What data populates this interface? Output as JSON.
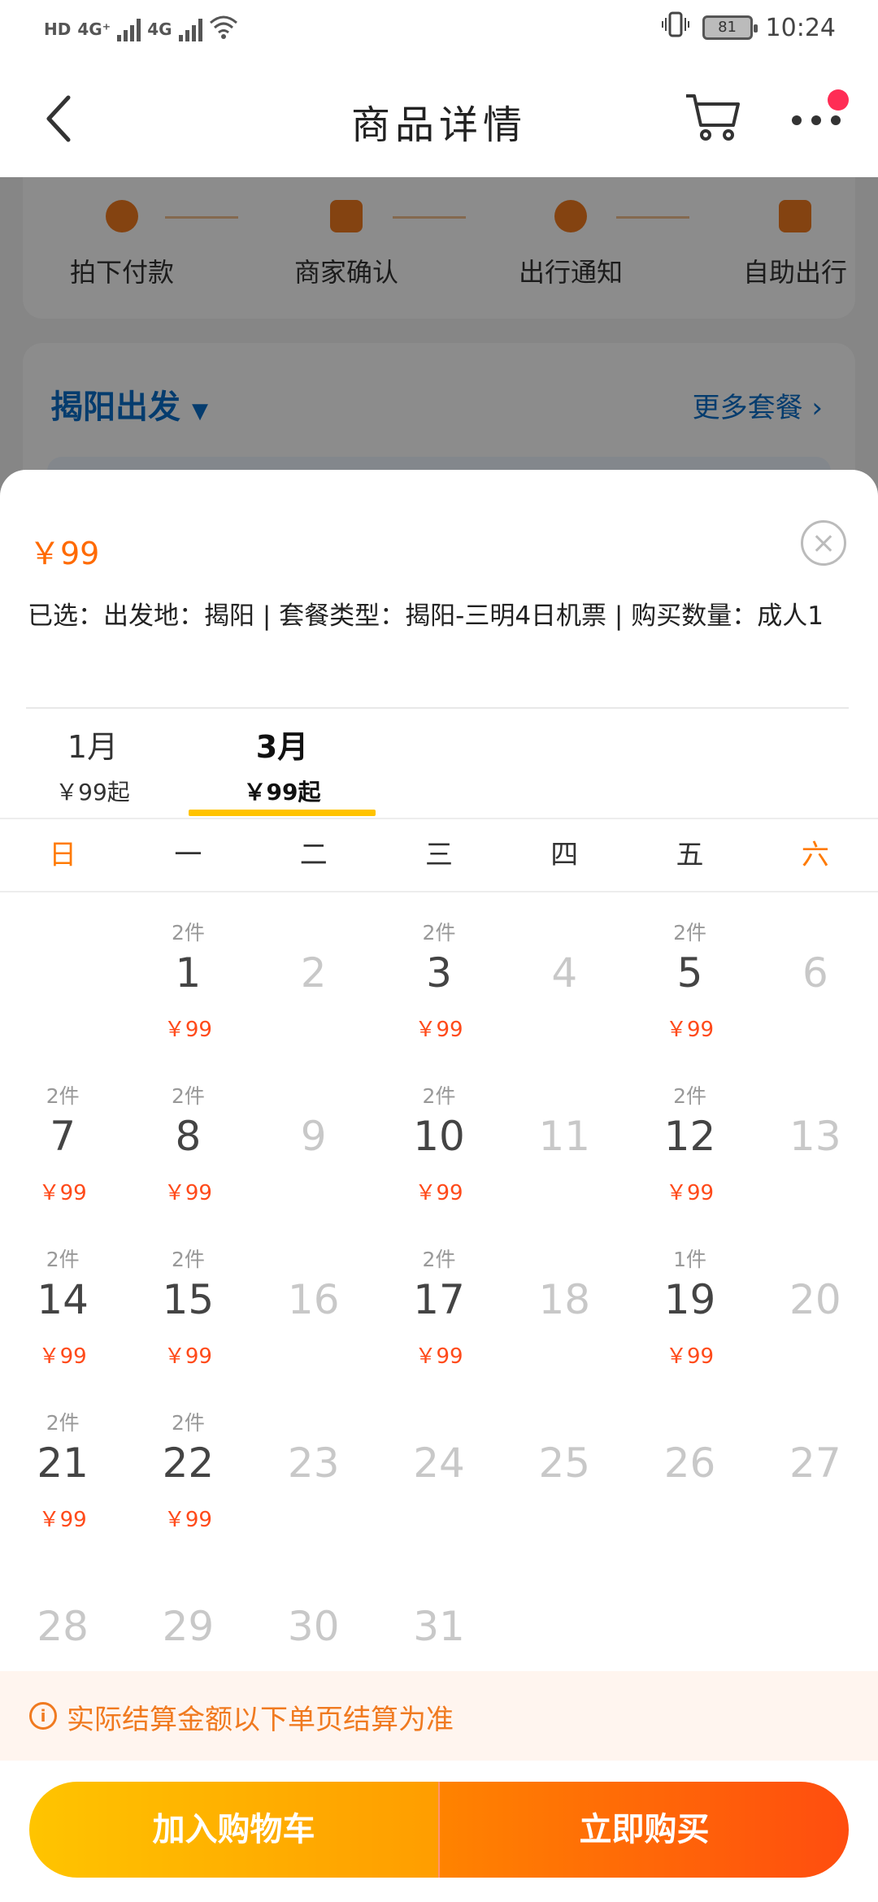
{
  "status_bar": {
    "left_badges": [
      "HD",
      "4G⁺",
      "4G"
    ],
    "battery": "81",
    "time": "10:24"
  },
  "header": {
    "title": "商品详情",
    "icons": [
      "back-arrow-icon",
      "cart-icon",
      "more-dots-icon"
    ]
  },
  "background_page": {
    "steps": [
      {
        "label": "拍下付款",
        "icon": "yen-icon"
      },
      {
        "label": "商家确认",
        "icon": "verify-icon"
      },
      {
        "label": "出行通知",
        "icon": "bell-icon"
      },
      {
        "label": "自助出行",
        "icon": "luggage-icon"
      }
    ],
    "departure": "揭阳出发",
    "more_packages": "更多套餐 ›"
  },
  "sheet": {
    "price": "￥99",
    "selected": "已选：出发地：揭阳 | 套餐类型：揭阳-三明4日机票 | 购买数量：成人1",
    "months": [
      {
        "month": "1月",
        "price": "￥99起",
        "active": false
      },
      {
        "month": "3月",
        "price": "￥99起",
        "active": true
      }
    ],
    "weekdays": [
      "日",
      "一",
      "二",
      "三",
      "四",
      "五",
      "六"
    ],
    "calendar": [
      {
        "day": "1",
        "stock": "2件",
        "price": "￥99"
      },
      {
        "day": "2",
        "stock": "",
        "price": ""
      },
      {
        "day": "3",
        "stock": "2件",
        "price": "￥99"
      },
      {
        "day": "4",
        "stock": "",
        "price": ""
      },
      {
        "day": "5",
        "stock": "2件",
        "price": "￥99"
      },
      {
        "day": "6",
        "stock": "",
        "price": ""
      },
      {
        "day": "7",
        "stock": "2件",
        "price": "￥99"
      },
      {
        "day": "8",
        "stock": "2件",
        "price": "￥99"
      },
      {
        "day": "9",
        "stock": "",
        "price": ""
      },
      {
        "day": "10",
        "stock": "2件",
        "price": "￥99"
      },
      {
        "day": "11",
        "stock": "",
        "price": ""
      },
      {
        "day": "12",
        "stock": "2件",
        "price": "￥99"
      },
      {
        "day": "13",
        "stock": "",
        "price": ""
      },
      {
        "day": "14",
        "stock": "2件",
        "price": "￥99"
      },
      {
        "day": "15",
        "stock": "2件",
        "price": "￥99"
      },
      {
        "day": "16",
        "stock": "",
        "price": ""
      },
      {
        "day": "17",
        "stock": "2件",
        "price": "￥99"
      },
      {
        "day": "18",
        "stock": "",
        "price": ""
      },
      {
        "day": "19",
        "stock": "1件",
        "price": "￥99"
      },
      {
        "day": "20",
        "stock": "",
        "price": ""
      },
      {
        "day": "21",
        "stock": "2件",
        "price": "￥99"
      },
      {
        "day": "22",
        "stock": "2件",
        "price": "￥99"
      },
      {
        "day": "23",
        "stock": "",
        "price": ""
      },
      {
        "day": "24",
        "stock": "",
        "price": ""
      },
      {
        "day": "25",
        "stock": "",
        "price": ""
      },
      {
        "day": "26",
        "stock": "",
        "price": ""
      },
      {
        "day": "27",
        "stock": "",
        "price": ""
      },
      {
        "day": "28",
        "stock": "",
        "price": ""
      },
      {
        "day": "29",
        "stock": "",
        "price": ""
      },
      {
        "day": "30",
        "stock": "",
        "price": ""
      },
      {
        "day": "31",
        "stock": "",
        "price": ""
      }
    ],
    "notice": "实际结算金额以下单页结算为准",
    "add_to_cart": "加入购物车",
    "buy_now": "立即购买"
  },
  "colors": {
    "accent_orange": "#ff6a00",
    "price_red": "#ff4a1a",
    "tab_yellow": "#ffc300",
    "link_blue": "#0a6ec8"
  }
}
